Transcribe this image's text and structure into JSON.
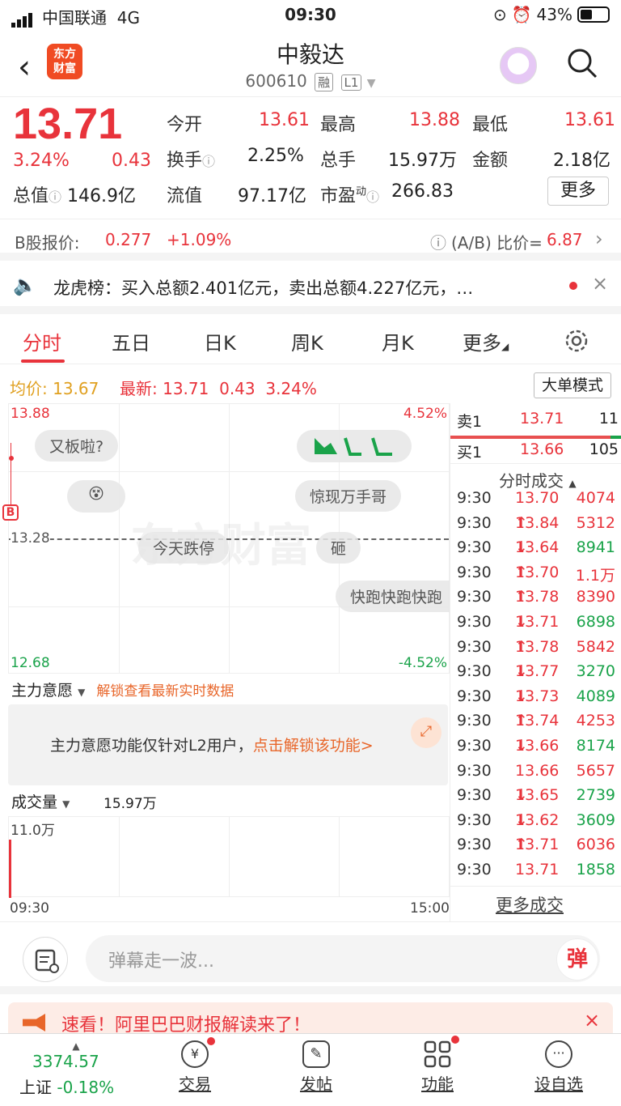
{
  "status": {
    "carrier": "中国联通",
    "network": "4G",
    "time": "09:30",
    "battery": "43%"
  },
  "header": {
    "logo_line1": "东方",
    "logo_line2": "财富",
    "title": "中毅达",
    "code": "600610",
    "tag1": "融",
    "tag2": "L1"
  },
  "quote": {
    "price": "13.71",
    "change_pct": "3.24%",
    "change": "0.43",
    "open_label": "今开",
    "open": "13.61",
    "high_label": "最高",
    "high": "13.88",
    "low_label": "最低",
    "low": "13.61",
    "turnover_label": "换手",
    "turnover": "2.25%",
    "volume_label": "总手",
    "volume": "15.97万",
    "amount_label": "金额",
    "amount": "2.18亿",
    "mktcap_label": "总值",
    "mktcap": "146.9亿",
    "float_label": "流值",
    "float": "97.17亿",
    "pe_label": "市盈",
    "pe_sup": "动",
    "pe": "266.83",
    "more_label": "更多"
  },
  "bstock": {
    "label": "B股报价:",
    "price": "0.277",
    "change": "+1.09%",
    "ratio_label": "(A/B) 比价=",
    "ratio": "6.87"
  },
  "dragon": {
    "text": "龙虎榜：买入总额2.401亿元，卖出总额4.227亿元，…"
  },
  "tabs": [
    "分时",
    "五日",
    "日K",
    "周K",
    "月K",
    "更多"
  ],
  "legend": {
    "avg_label": "均价:",
    "avg": "13.67",
    "latest_label": "最新:",
    "latest": "13.71",
    "chg": "0.43",
    "pct": "3.24%",
    "mode": "大单模式"
  },
  "chart": {
    "top_price": "13.88",
    "top_pct": "4.52%",
    "mid_price": "13.28",
    "bottom_price": "12.68",
    "bottom_pct": "-4.52%",
    "bubbles": [
      "又板啦?",
      "惊现万手哥",
      "今天跌停",
      "砸",
      "快跑快跑快跑"
    ],
    "watermark": "东方财富",
    "b_marker": "B"
  },
  "orderbook": {
    "sell_label": "卖1",
    "sell_price": "13.71",
    "sell_vol": "11",
    "buy_label": "买1",
    "buy_price": "13.66",
    "buy_vol": "105",
    "ticks_title": "分时成交",
    "ticks": [
      {
        "t": "9:30",
        "p": "13.70",
        "d": "",
        "v": "4074",
        "c": "red"
      },
      {
        "t": "9:30",
        "p": "13.84",
        "d": "↑",
        "v": "5312",
        "c": "red"
      },
      {
        "t": "9:30",
        "p": "13.64",
        "d": "↓",
        "v": "8941",
        "c": "green"
      },
      {
        "t": "9:30",
        "p": "13.70",
        "d": "↑",
        "v": "1.1万",
        "c": "red"
      },
      {
        "t": "9:30",
        "p": "13.78",
        "d": "↑",
        "v": "8390",
        "c": "red"
      },
      {
        "t": "9:30",
        "p": "13.71",
        "d": "↓",
        "v": "6898",
        "c": "green"
      },
      {
        "t": "9:30",
        "p": "13.78",
        "d": "↑",
        "v": "5842",
        "c": "red"
      },
      {
        "t": "9:30",
        "p": "13.77",
        "d": "↓",
        "v": "3270",
        "c": "green"
      },
      {
        "t": "9:30",
        "p": "13.73",
        "d": "↓",
        "v": "4089",
        "c": "green"
      },
      {
        "t": "9:30",
        "p": "13.74",
        "d": "↑",
        "v": "4253",
        "c": "red"
      },
      {
        "t": "9:30",
        "p": "13.66",
        "d": "↓",
        "v": "8174",
        "c": "green"
      },
      {
        "t": "9:30",
        "p": "13.66",
        "d": "",
        "v": "5657",
        "c": "red"
      },
      {
        "t": "9:30",
        "p": "13.65",
        "d": "↓",
        "v": "2739",
        "c": "green"
      },
      {
        "t": "9:30",
        "p": "13.62",
        "d": "↓",
        "v": "3609",
        "c": "green"
      },
      {
        "t": "9:30",
        "p": "13.71",
        "d": "↑",
        "v": "6036",
        "c": "red"
      },
      {
        "t": "9:30",
        "p": "13.71",
        "d": "",
        "v": "1858",
        "c": "green"
      }
    ],
    "more": "更多成交"
  },
  "mainforce": {
    "label": "主力意愿",
    "unlock_link": "解锁查看最新实时数据",
    "notice": "主力意愿功能仅针对L2用户，",
    "notice_link": "点击解锁该功能>"
  },
  "volume": {
    "label": "成交量",
    "total": "15.97万",
    "max": "11.0万",
    "start_time": "09:30",
    "end_time": "15:00"
  },
  "comment": {
    "placeholder": "弹幕走一波...",
    "dan": "弹"
  },
  "news": {
    "text": "速看！阿里巴巴财报解读来了！"
  },
  "nav": {
    "index_value": "3374.57",
    "index_name": "上证",
    "index_change": "-0.18%",
    "items": [
      "交易",
      "发帖",
      "功能",
      "设自选"
    ]
  },
  "colors": {
    "up": "#e8333b",
    "down": "#1aa34a",
    "accent": "#e8662a"
  }
}
